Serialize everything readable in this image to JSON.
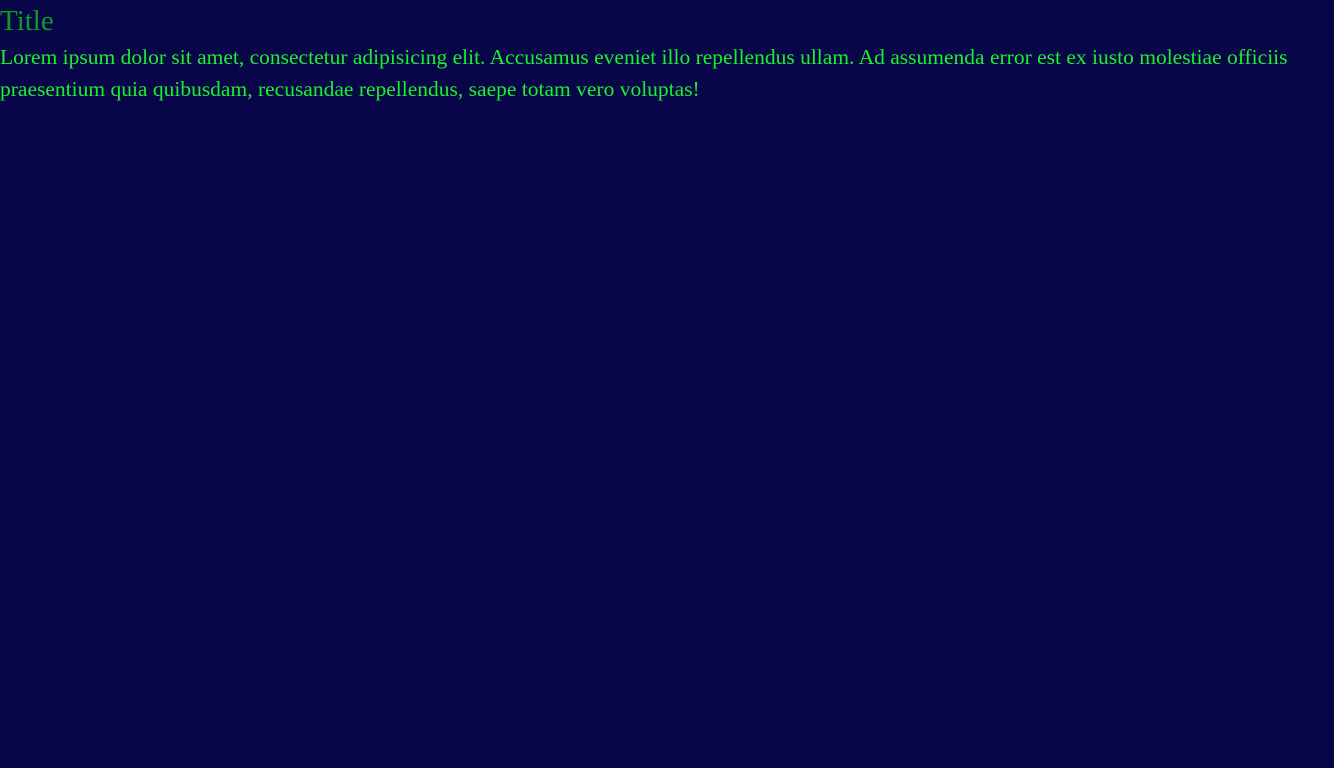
{
  "page": {
    "title": "Title",
    "paragraph": "Lorem ipsum dolor sit amet, consectetur adipisicing elit. Accusamus eveniet illo repellendus ullam. Ad assumenda error est ex iusto molestiae officiis praesentium quia quibusdam, recusandae repellendus, saepe totam vero voluptas!"
  },
  "colors": {
    "background": "#080649",
    "title": "#0d9b22",
    "text": "#18f12f"
  }
}
